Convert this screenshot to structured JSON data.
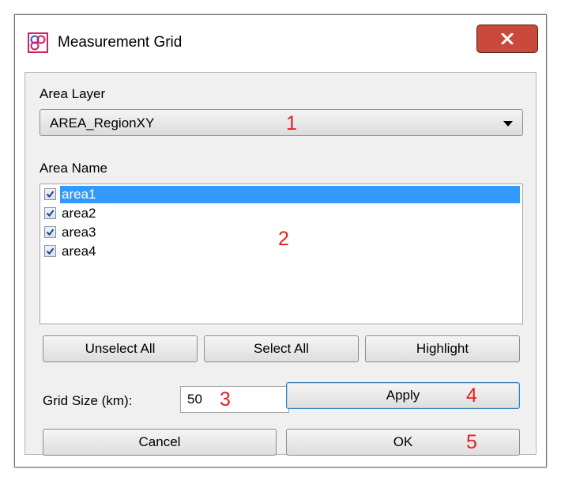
{
  "window": {
    "title": "Measurement Grid",
    "icon": "measurement-grid-app-icon",
    "close_icon": "close-x-icon"
  },
  "area_layer": {
    "label": "Area Layer",
    "selected_value": "AREA_RegionXY"
  },
  "area_name": {
    "label": "Area Name",
    "items": [
      {
        "label": "area1",
        "checked": true,
        "selected": true
      },
      {
        "label": "area2",
        "checked": true,
        "selected": false
      },
      {
        "label": "area3",
        "checked": true,
        "selected": false
      },
      {
        "label": "area4",
        "checked": true,
        "selected": false
      }
    ]
  },
  "buttons": {
    "unselect_all": "Unselect All",
    "select_all": "Select All",
    "highlight": "Highlight",
    "apply": "Apply",
    "cancel": "Cancel",
    "ok": "OK"
  },
  "grid_size": {
    "label": "Grid Size (km):",
    "value": "50"
  },
  "annotations": [
    "1",
    "2",
    "3",
    "4",
    "5"
  ],
  "colors": {
    "selection": "#3399ff",
    "annotation": "#e8201c",
    "close_button": "#c94a3c"
  }
}
